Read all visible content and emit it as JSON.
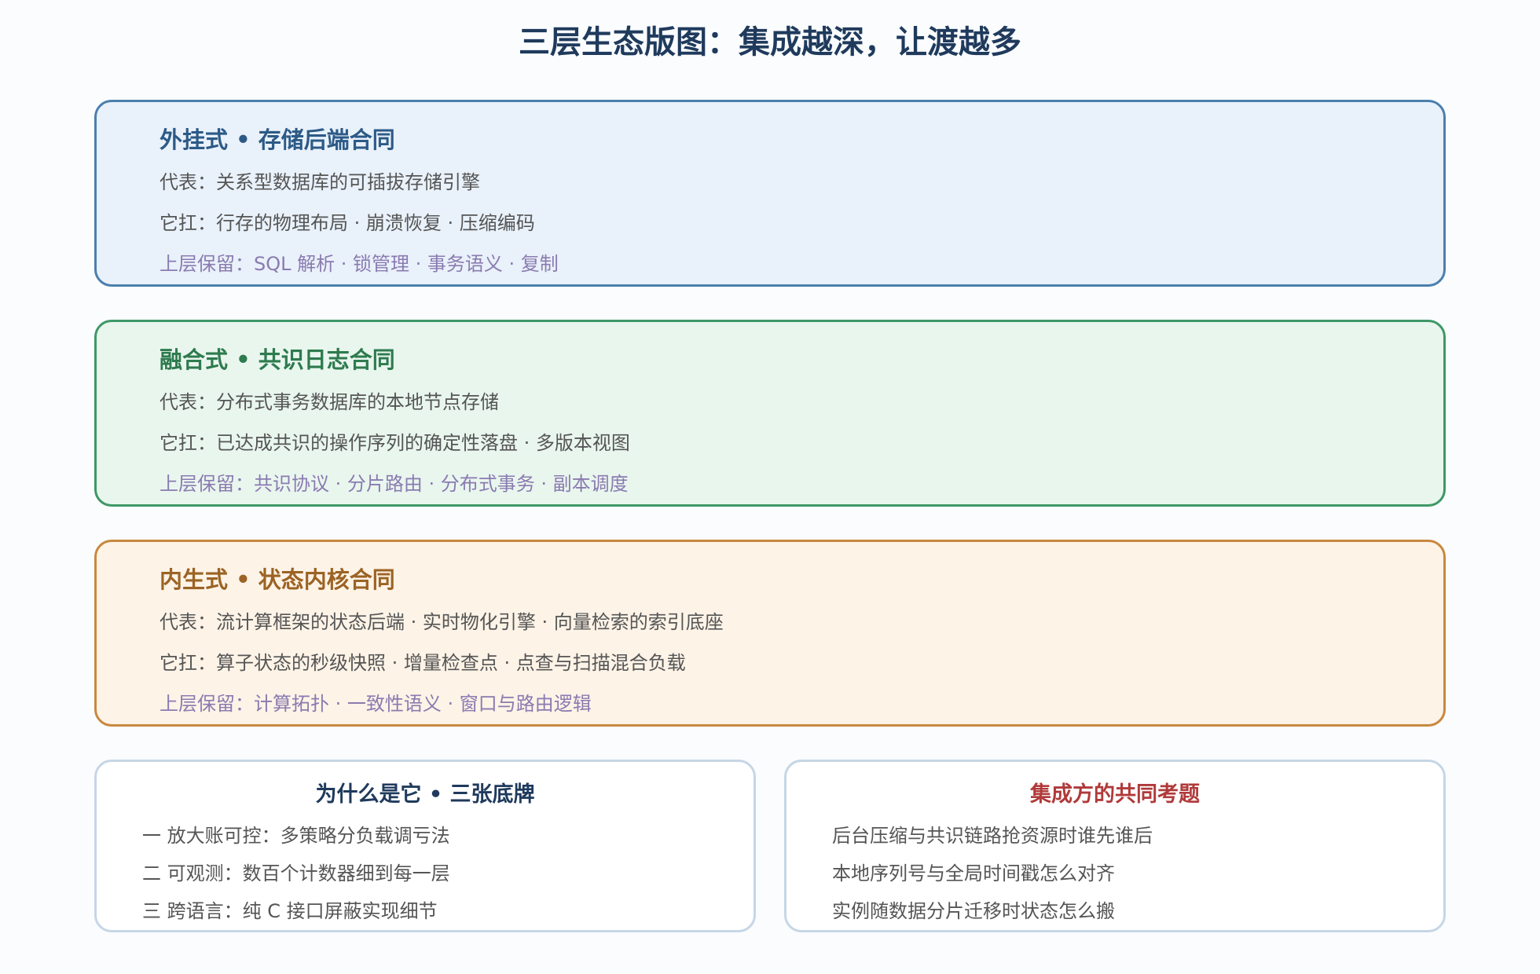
{
  "title": "三层生态版图：集成越深，让渡越多",
  "tiers": [
    {
      "title": "外挂式 • 存储后端合同",
      "representative": "代表：关系型数据库的可插拔存储引擎",
      "carries": "它扛：行存的物理布局 · 崩溃恢复 · 压缩编码",
      "retained": "上层保留：SQL 解析 · 锁管理 · 事务语义 · 复制",
      "colors": {
        "border": "#4b7fad",
        "background": "#e9f1fa",
        "title": "#2c5a87"
      }
    },
    {
      "title": "融合式 • 共识日志合同",
      "representative": "代表：分布式事务数据库的本地节点存储",
      "carries": "它扛：已达成共识的操作序列的确定性落盘 · 多版本视图",
      "retained": "上层保留：共识协议 · 分片路由 · 分布式事务 · 副本调度",
      "colors": {
        "border": "#3e9866",
        "background": "#e9f6ee",
        "title": "#2e7b4e"
      }
    },
    {
      "title": "内生式 • 状态内核合同",
      "representative": "代表：流计算框架的状态后端 · 实时物化引擎 · 向量检索的索引底座",
      "carries": "它扛：算子状态的秒级快照 · 增量检查点 · 点查与扫描混合负载",
      "retained": "上层保留：计算拓扑 · 一致性语义 · 窗口与路由逻辑",
      "colors": {
        "border": "#c8883f",
        "background": "#fdf3e7",
        "title": "#9b6324"
      }
    }
  ],
  "why_card": {
    "title": "为什么是它 • 三张底牌",
    "items": [
      "一 放大账可控：多策略分负载调亏法",
      "二 可观测：数百个计数器细到每一层",
      "三 跨语言：纯 C 接口屏蔽实现细节"
    ]
  },
  "challenge_card": {
    "title": "集成方的共同考题",
    "items": [
      "后台压缩与共识链路抢资源时谁先谁后",
      "本地序列号与全局时间戳怎么对齐",
      "实例随数据分片迁移时状态怎么搬"
    ]
  },
  "colors": {
    "title": "#1f3a5c",
    "card_border": "#c6d6e5",
    "challenge_title": "#b03a3a",
    "retained_text": "#8a7bb0"
  }
}
